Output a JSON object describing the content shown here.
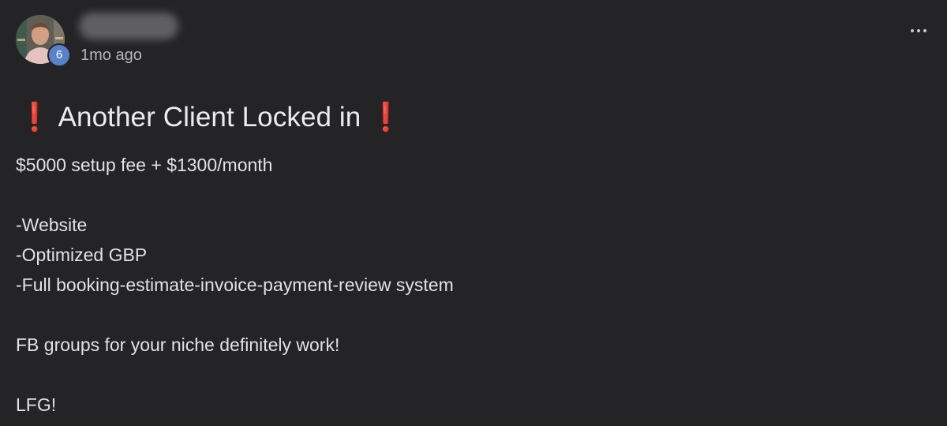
{
  "post": {
    "author_level": "6",
    "timestamp": "1mo ago",
    "title": "Another Client Locked in",
    "title_emoji_left": "❗",
    "title_emoji_right": "❗",
    "lines": [
      "$5000 setup fee + $1300/month",
      "-Website",
      "-Optimized GBP",
      "-Full booking-estimate-invoice-payment-review system",
      "FB groups for your niche definitely work!",
      "LFG!"
    ]
  },
  "icons": {
    "menu": "more-horizontal-icon",
    "title_emoji": "red-exclamation-icon"
  },
  "colors": {
    "background": "#242427",
    "badge": "#5a82c9",
    "emoji": "#e0242a",
    "text": "#e6e6e8",
    "muted": "#b7b7bb"
  }
}
